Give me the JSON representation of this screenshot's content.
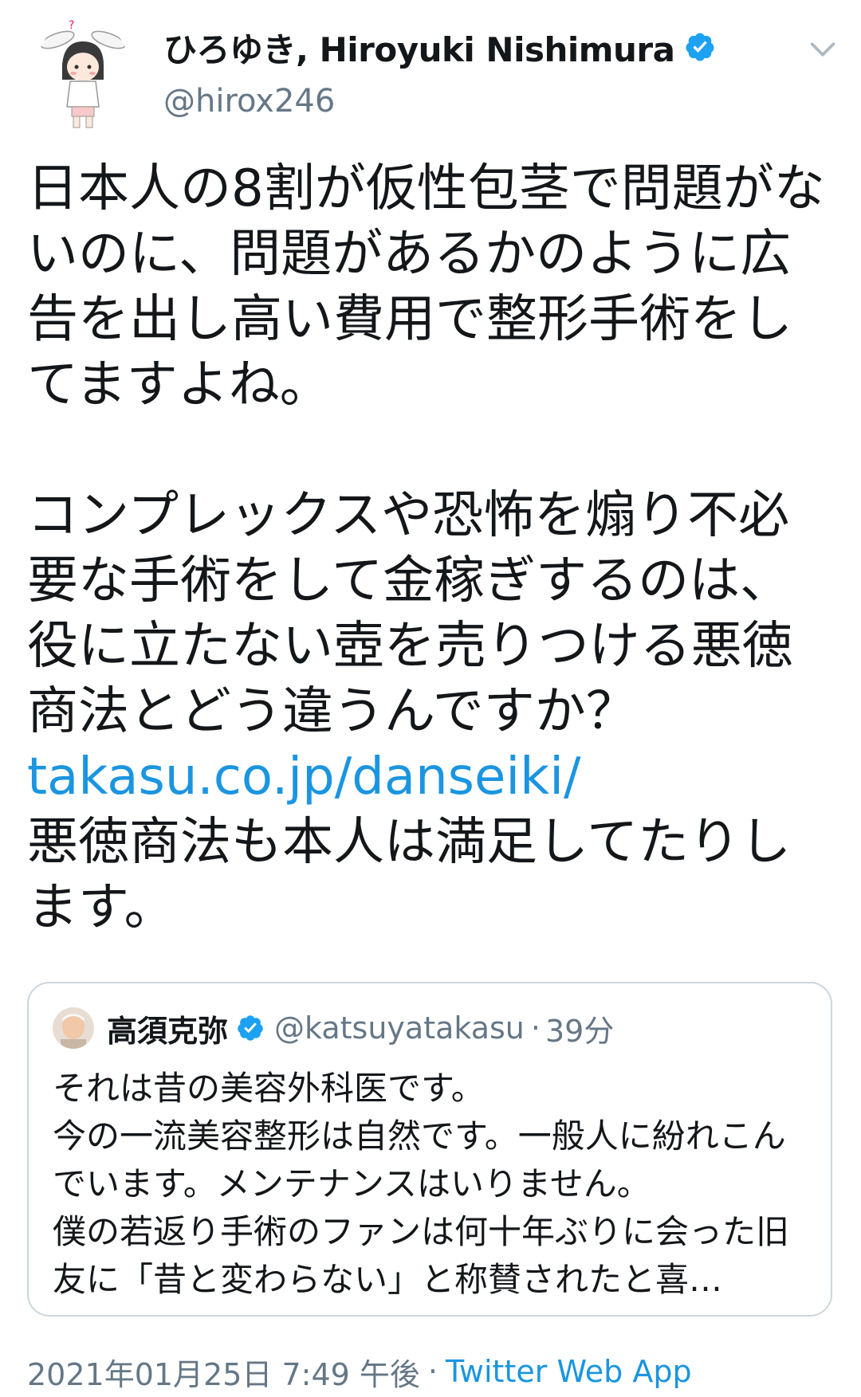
{
  "author": {
    "display_name": "ひろゆき, Hiroyuki Nishimura",
    "handle": "@hirox246",
    "verified": true,
    "avatar": "rabbit-eared-character-avatar"
  },
  "tweet": {
    "para1": "日本人の8割が仮性包茎で問題がないのに、問題があるかのように広告を出し高い費用で整形手術をしてますよね。",
    "para2": "コンプレックスや恐怖を煽り不必要な手術をして金稼ぎするのは、役に立たない壺を売りつける悪徳商法とどう違うんですか？",
    "link": "takasu.co.jp/danseiki/",
    "para3": "悪徳商法も本人は満足してたりします。"
  },
  "quoted_tweet": {
    "display_name": "高須克弥",
    "handle": "@katsuyatakasu",
    "separator": "·",
    "time": "39分",
    "verified": true,
    "avatar": "person-photo-avatar",
    "text": "それは昔の美容外科医です。\n今の一流美容整形は自然です。一般人に紛れこんでいます。メンテナンスはいりません。\n僕の若返り手術のファンは何十年ぶりに会った旧友に「昔と変わらない」と称賛されたと喜…"
  },
  "footer": {
    "timestamp": "2021年01月25日 7:49 午後",
    "separator": "·",
    "source": "Twitter Web App"
  },
  "colors": {
    "link": "#1b95e0",
    "secondary_text": "#657786",
    "border": "#ccd6dd",
    "verified": "#1da1f2"
  }
}
